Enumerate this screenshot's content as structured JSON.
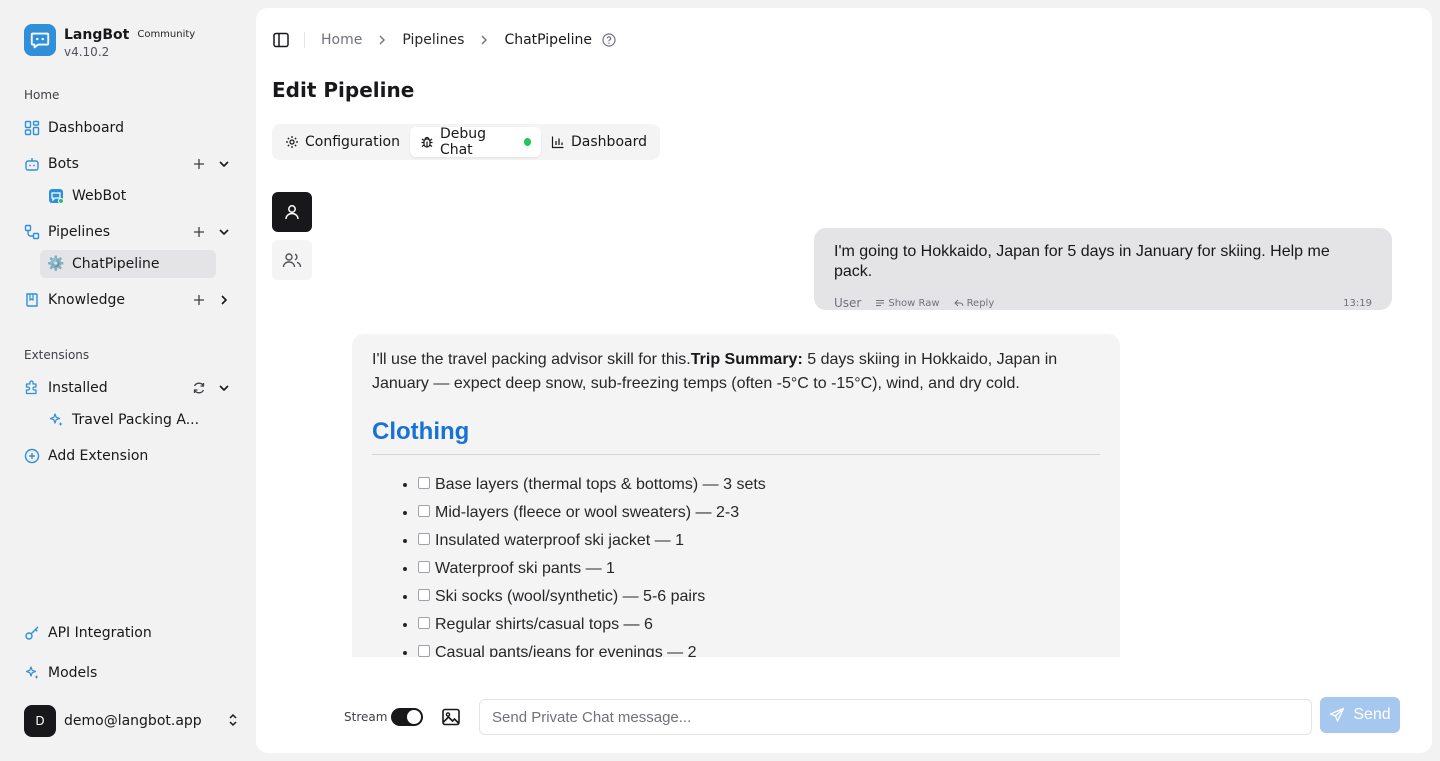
{
  "brand": {
    "name": "LangBot",
    "badge": "Community",
    "version": "v4.10.2"
  },
  "sidebar": {
    "home_label": "Home",
    "dashboard": "Dashboard",
    "bots": {
      "label": "Bots",
      "items": [
        "WebBot"
      ]
    },
    "pipelines": {
      "label": "Pipelines",
      "items": [
        "ChatPipeline"
      ]
    },
    "knowledge": "Knowledge",
    "extensions_label": "Extensions",
    "installed": {
      "label": "Installed",
      "items": [
        "Travel Packing A..."
      ]
    },
    "add_extension": "Add Extension",
    "api_integration": "API Integration",
    "models": "Models",
    "user": {
      "initial": "D",
      "email": "demo@langbot.app"
    }
  },
  "breadcrumb": {
    "home": "Home",
    "pipelines": "Pipelines",
    "current": "ChatPipeline"
  },
  "page": {
    "title": "Edit Pipeline"
  },
  "tabs": {
    "configuration": "Configuration",
    "debug_chat": "Debug Chat",
    "dashboard": "Dashboard"
  },
  "chat": {
    "user_message": {
      "text": "I'm going to Hokkaido, Japan for 5 days in January for skiing. Help me pack.",
      "sender": "User",
      "show_raw": "Show Raw",
      "reply": "Reply",
      "time": "13:19"
    },
    "bot_message": {
      "intro": "I'll use the travel packing advisor skill for this.",
      "summary_label": "Trip Summary:",
      "summary_text": " 5 days skiing in Hokkaido, Japan in January — expect deep snow, sub-freezing temps (often -5°C to -15°C), wind, and dry cold.",
      "heading": "Clothing",
      "items": [
        "Base layers (thermal tops & bottoms) — 3 sets",
        "Mid-layers (fleece or wool sweaters) — 2-3",
        "Insulated waterproof ski jacket — 1",
        "Waterproof ski pants — 1",
        "Ski socks (wool/synthetic) — 5-6 pairs",
        "Regular shirts/casual tops — 6",
        "Casual pants/jeans for evenings — 2"
      ]
    }
  },
  "composer": {
    "stream_label": "Stream",
    "placeholder": "Send Private Chat message...",
    "send_label": "Send"
  },
  "colors": {
    "accent": "#2f8fd8",
    "heading_blue": "#1872d6",
    "status_green": "#22c55e",
    "send_disabled": "#a6c8ef"
  }
}
